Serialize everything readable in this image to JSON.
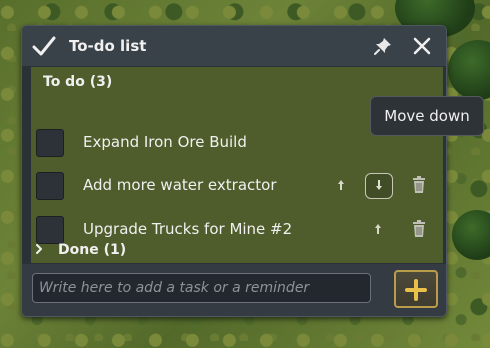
{
  "window": {
    "title": "To-do list",
    "icons": {
      "title": "checkmark-icon",
      "pin": "pin-icon",
      "close": "close-icon"
    }
  },
  "todo_section": {
    "label": "To do (3)"
  },
  "tasks": [
    {
      "label": "Expand Iron Ore Build"
    },
    {
      "label": "Add more water extractor"
    },
    {
      "label": "Upgrade Trucks for Mine #2"
    }
  ],
  "done_section": {
    "label": "Done (1)",
    "icon": "chevron-right-icon"
  },
  "input": {
    "placeholder": "Write here to add a task or a reminder",
    "value": ""
  },
  "add_button": {
    "icon": "plus-icon"
  },
  "tooltip": {
    "text": "Move down"
  },
  "colors": {
    "accent": "#e8c04a",
    "panel": "#2a3137",
    "list_bg": "#586a28"
  }
}
